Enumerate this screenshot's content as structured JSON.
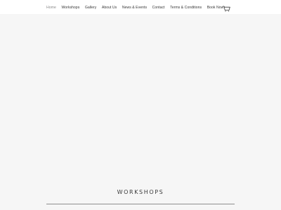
{
  "nav": {
    "items": [
      {
        "label": "Home",
        "active": true
      },
      {
        "label": "Workshops",
        "active": false
      },
      {
        "label": "Gallery",
        "active": false
      },
      {
        "label": "About Us",
        "active": false
      },
      {
        "label": "News & Events",
        "active": false
      },
      {
        "label": "Contact",
        "active": false
      },
      {
        "label": "Terms & Conditions",
        "active": false
      },
      {
        "label": "Book Now",
        "active": false
      }
    ],
    "cart_icon": "cart-icon"
  },
  "main": {
    "section_title": "WORKSHOPS"
  },
  "colors": {
    "page_background": "#f6f6f6",
    "header_background": "#ffffff",
    "text": "#3a3a3a",
    "active_text": "#8a8a8a",
    "divider": "#8e8e8e"
  }
}
